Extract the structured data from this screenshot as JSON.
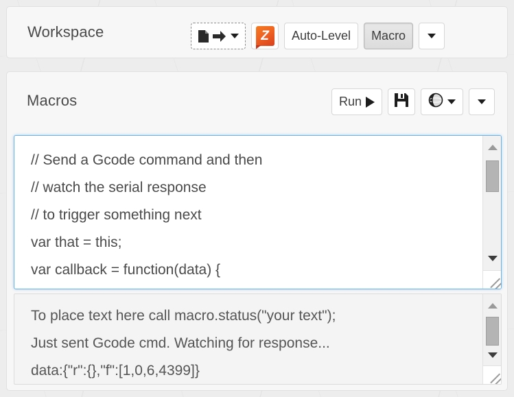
{
  "workspace": {
    "title": "Workspace",
    "buttons": {
      "export": {
        "name": "export-file-dropdown",
        "label": ""
      },
      "zlogo": {
        "name": "z-app-icon",
        "label": "Z"
      },
      "autolevel": {
        "label": "Auto-Level"
      },
      "macro": {
        "label": "Macro"
      },
      "overflow": {
        "label": ""
      }
    }
  },
  "macros": {
    "title": "Macros",
    "buttons": {
      "run": {
        "label": "Run"
      },
      "save": {
        "label": ""
      },
      "globe": {
        "label": ""
      },
      "overflow": {
        "label": ""
      }
    },
    "code": {
      "lines": [
        "// Send a Gcode command and then",
        "// watch the serial response",
        "// to trigger something next",
        "var that = this;",
        "var callback = function(data) {"
      ],
      "text": "// Send a Gcode command and then\n// watch the serial response\n// to trigger something next\nvar that = this;\nvar callback = function(data) {"
    },
    "status": {
      "lines": [
        "To place text here call macro.status(\"your text\");",
        "Just sent Gcode cmd. Watching for response...",
        "data:{\"r\":{},\"f\":[1,0,6,4399]}"
      ],
      "text": "To place text here call macro.status(\"your text\");\nJust sent Gcode cmd. Watching for response...\ndata:{\"r\":{},\"f\":[1,0,6,4399]}"
    }
  },
  "icons": {
    "export": "export-file-icon",
    "caret": "chevron-down-icon",
    "play": "play-icon",
    "save": "floppy-disk-icon",
    "globe": "globe-icon",
    "scroll_up": "scroll-up-arrow-icon",
    "scroll_down": "scroll-down-arrow-icon",
    "resize": "resize-grip-icon"
  },
  "colors": {
    "accent": "#66afe9",
    "brand_orange": "#ef6322",
    "panel_bg": "#f7f7f7",
    "text": "#4a4a4a"
  }
}
